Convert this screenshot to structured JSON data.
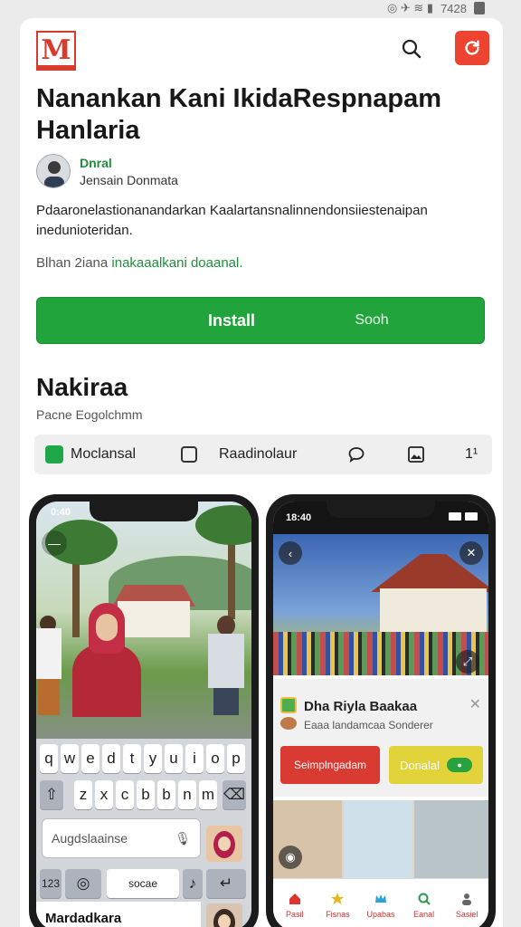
{
  "status_bar": {
    "time": "7428"
  },
  "header": {
    "logo_letter": "M",
    "title": "Nanankan Kani IkidaRespnapam Hanlaria"
  },
  "developer": {
    "name": "Dnral",
    "subtitle": "Jensain Donmata"
  },
  "description": "Pdaaronelastionanandarkan Kaalartansnalinnendonsiiestenaipan inedunioteridan.",
  "meta": {
    "prefix": "Blhan 2iana",
    "highlight": "inakaaalkani doaanal."
  },
  "actions": {
    "install_label": "Install",
    "secondary_label": "Sooh"
  },
  "section": {
    "title": "Nakiraa",
    "subtitle": "Pacne Eogolchmm"
  },
  "toolbar": {
    "item1": "Moclansal",
    "item2": "Raadinolaur",
    "item_last": "1¹"
  },
  "phone1": {
    "time": "0:40",
    "keyboard_rows": [
      [
        "q",
        "w",
        "e",
        "d",
        "t",
        "y",
        "u",
        "i",
        "o",
        "p"
      ],
      [
        "z",
        "x",
        "c",
        "b",
        "b",
        "n",
        "m"
      ]
    ],
    "input_placeholder": "Augdslaainse",
    "space_label": "socae",
    "bottom_text": "Mardadkara"
  },
  "phone2": {
    "time": "18:40",
    "sheet_title": "Dha Riyla Baakaa",
    "sheet_subtitle": "Eaaa landamcaa Sonderer",
    "red_button": "Seimplngadam",
    "yellow_button": "Donalal",
    "yellow_badge": "●",
    "nav": [
      "Pasil",
      "Fisnas",
      "Upabas",
      "Eanal",
      "Sasiel"
    ]
  },
  "colors": {
    "green": "#21a43c",
    "red": "#ec4430"
  }
}
